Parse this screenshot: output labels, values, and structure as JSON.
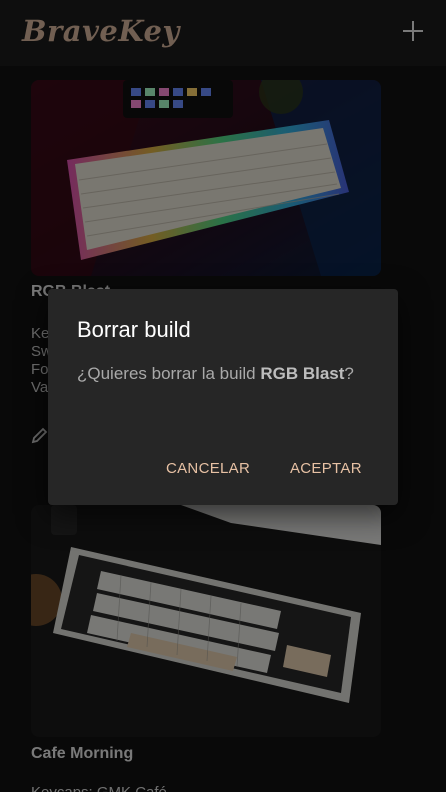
{
  "app": {
    "logo": "BraveKey"
  },
  "header": {
    "add_icon": "plus-icon"
  },
  "cards": [
    {
      "title": "RGB Blast",
      "detail_lines": [
        "Ke",
        "Sw",
        "Fo",
        "Va"
      ],
      "edit_icon": "pencil-icon"
    },
    {
      "title": "Cafe Morning",
      "detail_lines": [
        "Keycaps: GMK Café"
      ]
    }
  ],
  "dialog": {
    "title": "Borrar build",
    "message_prefix": "¿Quieres borrar la build ",
    "message_name": "RGB Blast",
    "message_suffix": "?",
    "cancel_label": "CANCELAR",
    "accept_label": "ACEPTAR"
  },
  "colors": {
    "accent": "#e7c1a4",
    "logo": "#d9b79e",
    "background": "#121212",
    "dialog": "#262626"
  }
}
